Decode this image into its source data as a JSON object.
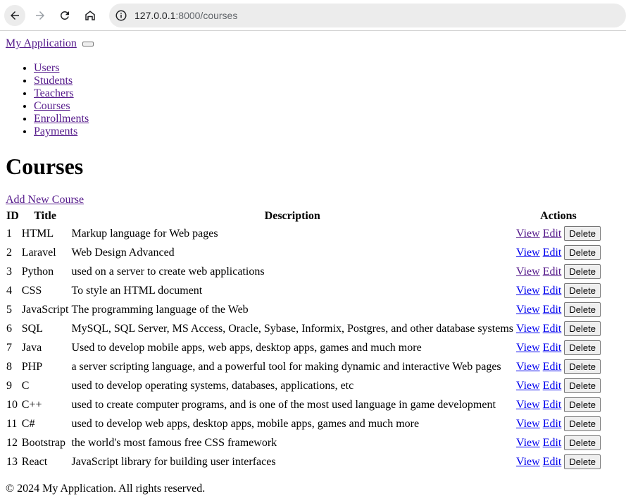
{
  "browser": {
    "url_host": "127.0.0.1",
    "url_path": ":8000/courses"
  },
  "brand": "My Application",
  "nav": [
    {
      "label": "Users"
    },
    {
      "label": "Students"
    },
    {
      "label": "Teachers"
    },
    {
      "label": "Courses"
    },
    {
      "label": "Enrollments"
    },
    {
      "label": "Payments"
    }
  ],
  "page_title": "Courses",
  "add_link": "Add New Course",
  "table": {
    "headers": {
      "id": "ID",
      "title": "Title",
      "description": "Description",
      "actions": "Actions"
    },
    "action_labels": {
      "view": "View",
      "edit": "Edit",
      "delete": "Delete"
    },
    "rows": [
      {
        "id": "1",
        "title": "HTML",
        "description": "Markup language for Web pages",
        "view_visited": true,
        "edit_visited": true
      },
      {
        "id": "2",
        "title": "Laravel",
        "description": "Web Design Advanced",
        "view_visited": false,
        "edit_visited": false
      },
      {
        "id": "3",
        "title": "Python",
        "description": "used on a server to create web applications",
        "view_visited": true,
        "edit_visited": true
      },
      {
        "id": "4",
        "title": "CSS",
        "description": "To style an HTML document",
        "view_visited": false,
        "edit_visited": false
      },
      {
        "id": "5",
        "title": "JavaScript",
        "description": "The programming language of the Web",
        "view_visited": false,
        "edit_visited": false
      },
      {
        "id": "6",
        "title": "SQL",
        "description": "MySQL, SQL Server, MS Access, Oracle, Sybase, Informix, Postgres, and other database systems",
        "view_visited": false,
        "edit_visited": false
      },
      {
        "id": "7",
        "title": "Java",
        "description": "Used to develop mobile apps, web apps, desktop apps, games and much more",
        "view_visited": false,
        "edit_visited": false
      },
      {
        "id": "8",
        "title": "PHP",
        "description": "a server scripting language, and a powerful tool for making dynamic and interactive Web pages",
        "view_visited": false,
        "edit_visited": false
      },
      {
        "id": "9",
        "title": "C",
        "description": "used to develop operating systems, databases, applications, etc",
        "view_visited": false,
        "edit_visited": false
      },
      {
        "id": "10",
        "title": "C++",
        "description": "used to create computer programs, and is one of the most used language in game development",
        "view_visited": false,
        "edit_visited": false
      },
      {
        "id": "11",
        "title": "C#",
        "description": "used to develop web apps, desktop apps, mobile apps, games and much more",
        "view_visited": false,
        "edit_visited": false
      },
      {
        "id": "12",
        "title": "Bootstrap",
        "description": "the world's most famous free CSS framework",
        "view_visited": false,
        "edit_visited": false
      },
      {
        "id": "13",
        "title": "React",
        "description": "JavaScript library for building user interfaces",
        "view_visited": false,
        "edit_visited": false
      }
    ]
  },
  "footer": "© 2024 My Application. All rights reserved.",
  "icons": {
    "back": "arrow-left-icon",
    "forward": "arrow-right-icon",
    "reload": "reload-icon",
    "home": "home-icon",
    "info": "info-icon"
  },
  "colors": {
    "link_unvisited": "#0000ee",
    "link_visited": "#551a8b"
  }
}
